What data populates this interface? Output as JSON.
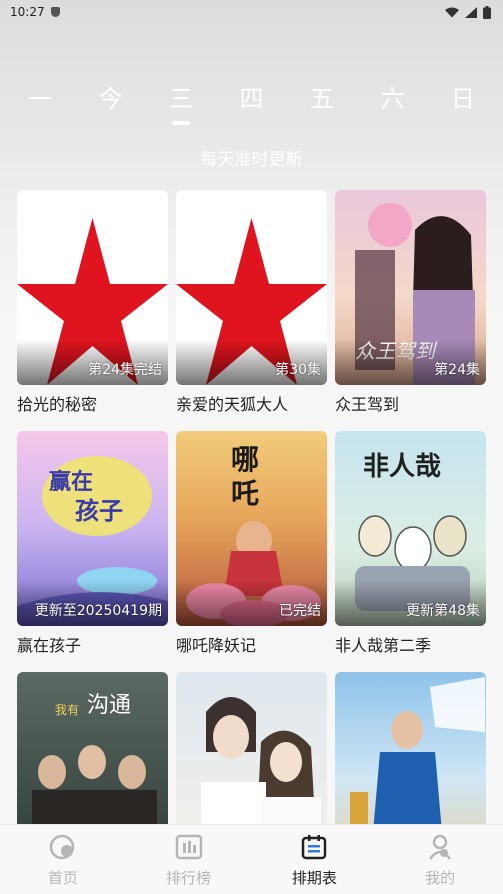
{
  "status": {
    "time": "10:27"
  },
  "weekdays": [
    {
      "label": "一",
      "active": false
    },
    {
      "label": "今",
      "active": false
    },
    {
      "label": "三",
      "active": true
    },
    {
      "label": "四",
      "active": false
    },
    {
      "label": "五",
      "active": false
    },
    {
      "label": "六",
      "active": false
    },
    {
      "label": "日",
      "active": false
    }
  ],
  "subtitle": "每天准时更新",
  "cards": [
    {
      "title": "拾光的秘密",
      "badge": "第24集完结",
      "poster": "star"
    },
    {
      "title": "亲爱的天狐大人",
      "badge": "第30集",
      "poster": "star"
    },
    {
      "title": "众王驾到",
      "badge": "第24集",
      "poster": "drama-costume"
    },
    {
      "title": "赢在孩子",
      "badge": "更新至20250419期",
      "poster": "variety-show"
    },
    {
      "title": "哪吒降妖记",
      "badge": "已完结",
      "poster": "nezha"
    },
    {
      "title": "非人哉第二季",
      "badge": "更新第48集",
      "poster": "cartoon"
    },
    {
      "title": "",
      "badge": "",
      "poster": "drama-group"
    },
    {
      "title": "",
      "badge": "",
      "poster": "romance"
    },
    {
      "title": "",
      "badge": "",
      "poster": "racing"
    }
  ],
  "tabs": [
    {
      "label": "首页",
      "icon": "home-icon",
      "active": false
    },
    {
      "label": "排行榜",
      "icon": "ranking-icon",
      "active": false
    },
    {
      "label": "排期表",
      "icon": "calendar-icon",
      "active": true
    },
    {
      "label": "我的",
      "icon": "profile-icon",
      "active": false
    }
  ],
  "colors": {
    "accent": "#222222",
    "inactive_tab": "#b5b5b5",
    "star_red": "#e0141e"
  }
}
